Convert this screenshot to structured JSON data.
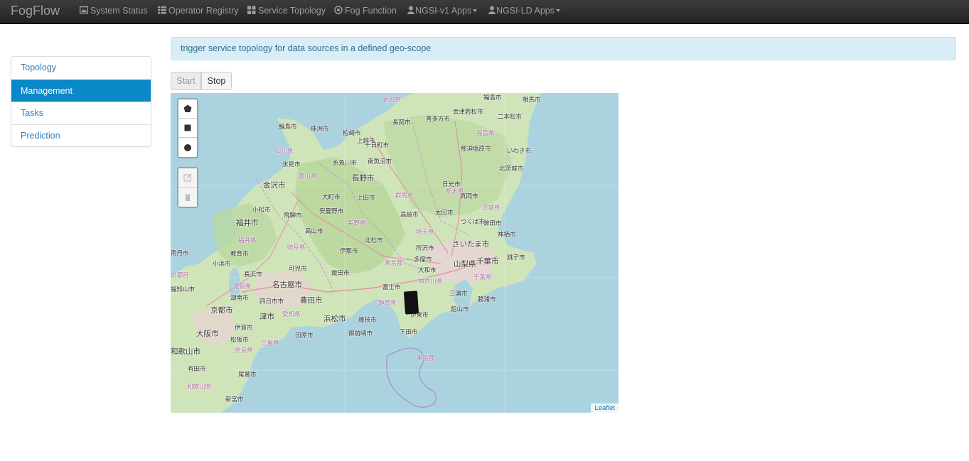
{
  "navbar": {
    "brand": "FogFlow",
    "items": [
      {
        "label": "System Status",
        "icon": "picture-icon"
      },
      {
        "label": "Operator Registry",
        "icon": "list-icon"
      },
      {
        "label": "Service Topology",
        "icon": "grid-icon"
      },
      {
        "label": "Fog Function",
        "icon": "circle-dot-icon"
      },
      {
        "label": "NGSI-v1 Apps",
        "icon": "user-icon"
      },
      {
        "label": "NGSI-LD Apps",
        "icon": "user-icon"
      }
    ]
  },
  "sidebar": {
    "items": [
      {
        "label": "Topology"
      },
      {
        "label": "Management"
      },
      {
        "label": "Tasks"
      },
      {
        "label": "Prediction"
      }
    ],
    "active": "Management"
  },
  "alert": {
    "text": "trigger service topology for data sources in a defined geo-scope"
  },
  "controls": {
    "start_label": "Start",
    "stop_label": "Stop"
  },
  "map": {
    "attribution": "Leaflet",
    "draw_tools": [
      "polygon-icon",
      "rectangle-icon",
      "circle-icon"
    ],
    "edit_tools": [
      "edit-icon",
      "trash-icon"
    ],
    "labels": [
      "新潟県",
      "福島市",
      "相馬市",
      "会津若松市",
      "喜多方市",
      "長岡市",
      "二本松市",
      "福島県",
      "輪島市",
      "珠洲市",
      "柏崎市",
      "十日町市",
      "上越市",
      "那須塩原市",
      "いわき市",
      "石川県",
      "氷見市",
      "糸魚川市",
      "南魚沼市",
      "北茨城市",
      "富山県",
      "長野市",
      "日光市",
      "金沢市",
      "大町市",
      "上田市",
      "群馬県",
      "栃木県",
      "真岡市",
      "小松市",
      "安曇野市",
      "高崎市",
      "太田市",
      "茨城県",
      "飛騨市",
      "福井市",
      "長野県",
      "つくば市",
      "鉾田市",
      "高山市",
      "埼玉県",
      "神栖市",
      "福井県",
      "北杜市",
      "所沢市",
      "さいたま市",
      "伊那市",
      "岐阜県",
      "多摩市",
      "千葉市",
      "南丹市",
      "教育市",
      "山梨県",
      "東京都",
      "銚子市",
      "小浜市",
      "大和市",
      "可児市",
      "長浜市",
      "飯田市",
      "千葉県",
      "神奈川県",
      "京都府",
      "名古屋市",
      "富士市",
      "三浦市",
      "福知山市",
      "滋賀県",
      "豊田市",
      "勝浦市",
      "湖南市",
      "京都市",
      "四日市市",
      "静岡県",
      "館山市",
      "藤枝市",
      "津市",
      "愛知県",
      "浜松市",
      "伊東市",
      "大阪市",
      "伊賀市",
      "田原市",
      "御前崎市",
      "下田市",
      "松阪市",
      "三重県",
      "和歌山市",
      "奈良県",
      "東京都",
      "有田市",
      "尾鷲市",
      "和歌山県",
      "新宮市"
    ]
  }
}
